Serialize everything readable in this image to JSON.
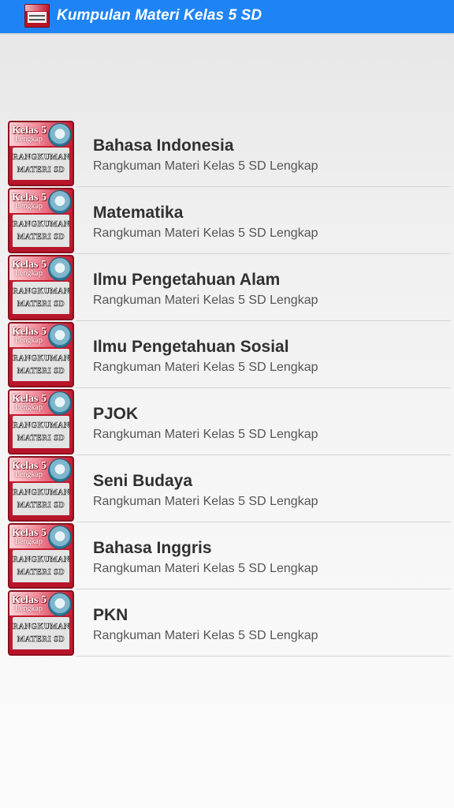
{
  "app": {
    "title": "Kumpulan Materi Kelas 5 SD",
    "icon": "book-cover-icon",
    "accent_color": "#1e84f5"
  },
  "thumbnail": {
    "title": "Kelas 5",
    "subtitle": "Lengkap",
    "body_line1": "RANGKUMAN",
    "body_line2": "MATERI SD",
    "frame_color": "#8a0f1e"
  },
  "items": [
    {
      "title": "Bahasa Indonesia",
      "subtitle": "Rangkuman Materi Kelas 5 SD Lengkap"
    },
    {
      "title": "Matematika",
      "subtitle": "Rangkuman Materi Kelas 5 SD Lengkap"
    },
    {
      "title": "Ilmu Pengetahuan Alam",
      "subtitle": "Rangkuman Materi Kelas 5 SD Lengkap"
    },
    {
      "title": "Ilmu Pengetahuan Sosial",
      "subtitle": "Rangkuman Materi Kelas 5 SD Lengkap"
    },
    {
      "title": "PJOK",
      "subtitle": "Rangkuman Materi Kelas 5 SD Lengkap"
    },
    {
      "title": "Seni Budaya",
      "subtitle": "Rangkuman Materi Kelas 5 SD Lengkap"
    },
    {
      "title": "Bahasa Inggris",
      "subtitle": "Rangkuman Materi Kelas 5 SD Lengkap"
    },
    {
      "title": "PKN",
      "subtitle": "Rangkuman Materi Kelas 5 SD Lengkap"
    }
  ]
}
